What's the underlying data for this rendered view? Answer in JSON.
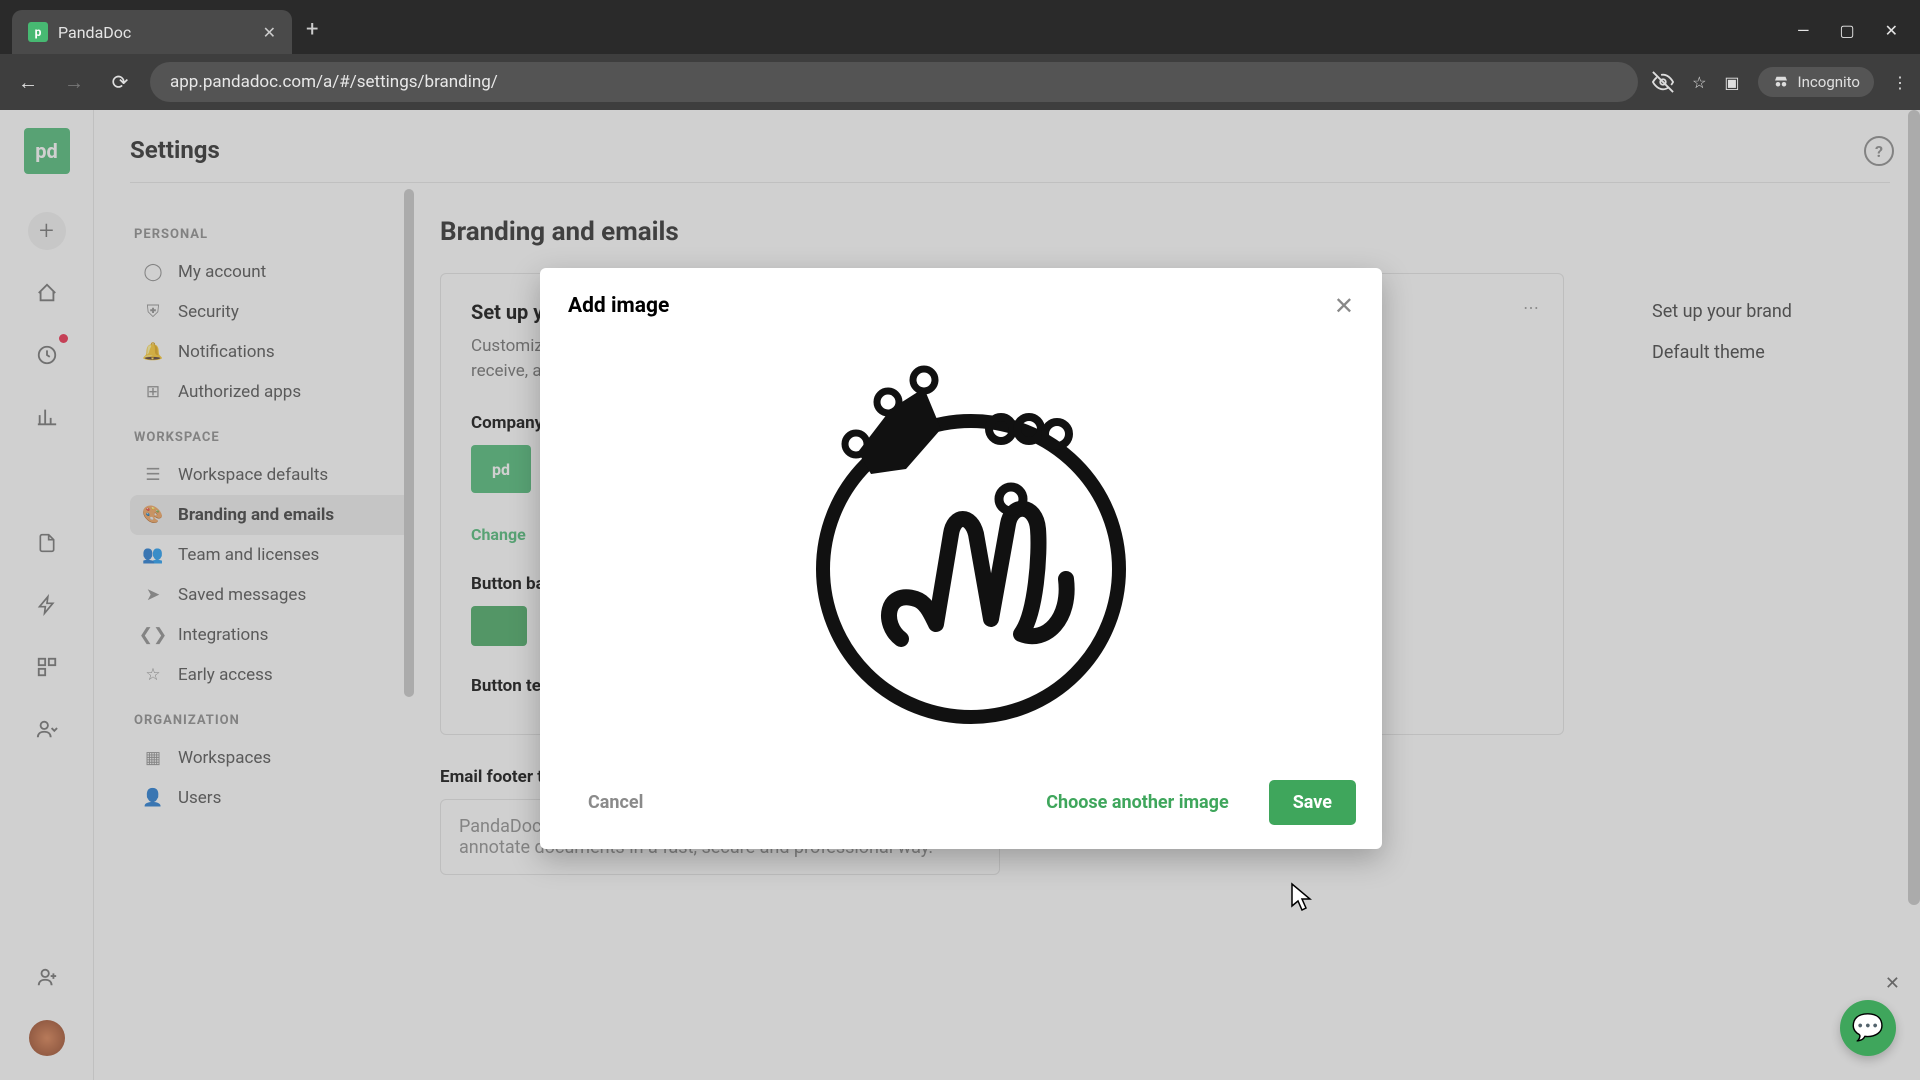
{
  "browser": {
    "tab_title": "PandaDoc",
    "url": "app.pandadoc.com/a/#/settings/branding/",
    "incognito_label": "Incognito"
  },
  "header": {
    "title": "Settings"
  },
  "sidebar": {
    "sections": {
      "personal": "PERSONAL",
      "workspace": "WORKSPACE",
      "organization": "ORGANIZATION"
    },
    "items": {
      "my_account": "My account",
      "security": "Security",
      "notifications": "Notifications",
      "authorized_apps": "Authorized apps",
      "workspace_defaults": "Workspace defaults",
      "branding": "Branding and emails",
      "team": "Team and licenses",
      "saved_messages": "Saved messages",
      "integrations": "Integrations",
      "early_access": "Early access",
      "workspaces": "Workspaces",
      "users": "Users"
    }
  },
  "main": {
    "heading": "Branding and emails",
    "brand_title": "Set up your brand",
    "brand_desc": "Customize the look of the documents you send, the emails your recipients receive, and your dashboard.",
    "company_logo_label": "Company logo",
    "change_link": "Change",
    "button_color_label": "Button background color",
    "button_text_label": "Button text color",
    "footer_label": "Email footer text",
    "footer_text": "PandaDoc is an application to create, send, track, sign and annotate documents in a fast, secure and professional way."
  },
  "rightcol": {
    "setup": "Set up your brand",
    "theme": "Default theme"
  },
  "modal": {
    "title": "Add image",
    "cancel": "Cancel",
    "choose": "Choose another image",
    "save": "Save"
  }
}
